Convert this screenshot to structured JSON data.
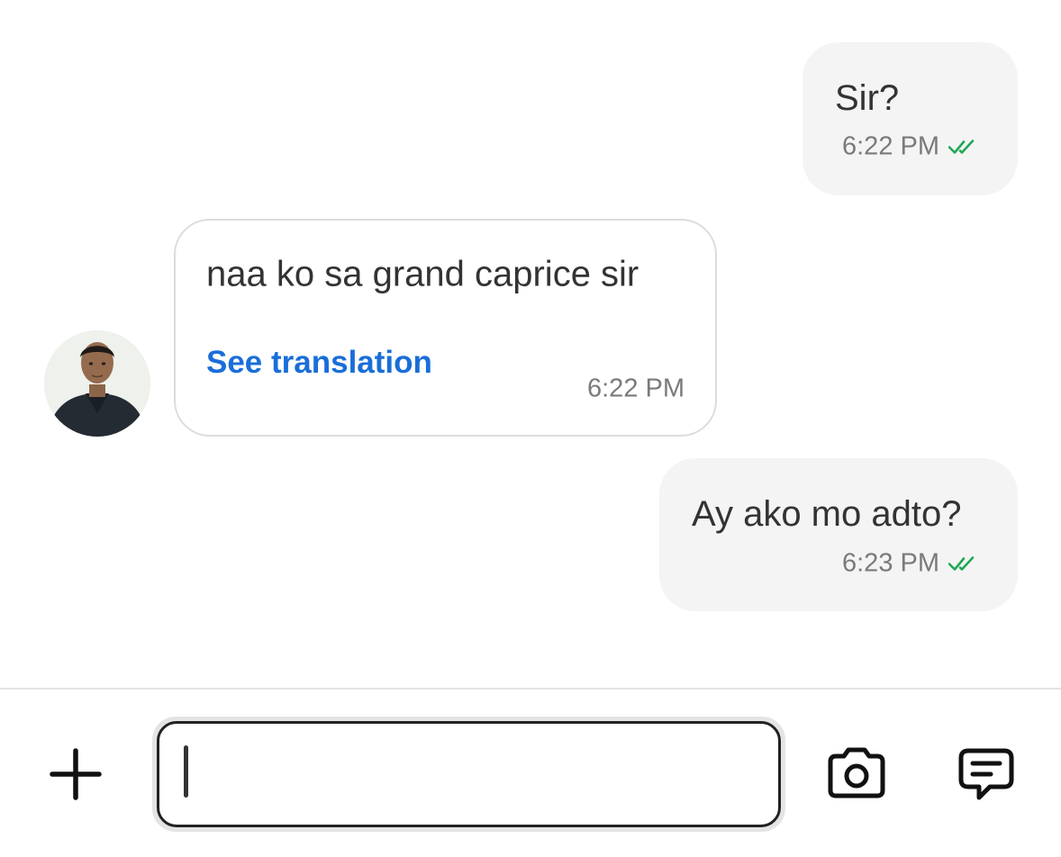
{
  "messages": [
    {
      "direction": "outgoing",
      "text": "Sir?",
      "time": "6:22 PM",
      "status_icon": "double-check-icon"
    },
    {
      "direction": "incoming",
      "text": "naa ko sa grand caprice sir",
      "translate_label": "See translation",
      "time": "6:22 PM"
    },
    {
      "direction": "outgoing",
      "text": "Ay ako mo adto?",
      "time": "6:23 PM",
      "status_icon": "double-check-icon"
    }
  ],
  "composer": {
    "placeholder": "",
    "value": "",
    "add_icon": "plus-icon",
    "camera_icon": "camera-icon",
    "chat_icon": "chat-bubble-icon"
  },
  "colors": {
    "outgoing_bubble": "#f4f4f4",
    "incoming_border": "#dcdcdc",
    "link": "#1a6ed8",
    "read_tick": "#1fa855",
    "meta_text": "#7a7a7a"
  }
}
